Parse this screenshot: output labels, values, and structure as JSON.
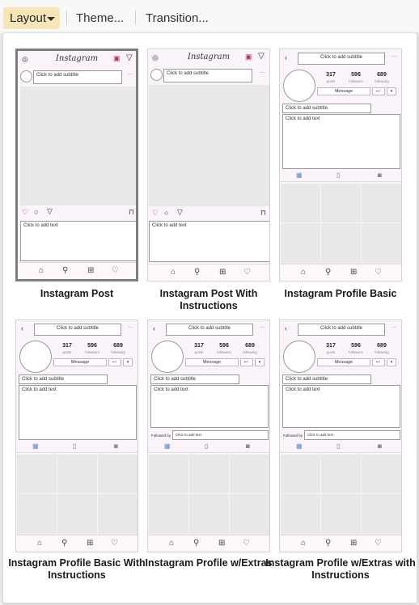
{
  "toolbar": {
    "layout_label": "Layout",
    "theme_label": "Theme...",
    "transition_label": "Transition..."
  },
  "strings": {
    "instagram": "Instagram",
    "subtitle": "Click to add subtitle",
    "text": "Click to add text",
    "message": "Message",
    "followed_by": "Followed by",
    "more": "···",
    "follow_check": "▪✓",
    "down": "▾"
  },
  "stats": {
    "posts_num": "317",
    "posts_lbl": "posts",
    "followers_num": "596",
    "followers_lbl": "followers",
    "following_num": "689",
    "following_lbl": "following"
  },
  "layouts": [
    {
      "name": "Instagram Post",
      "selected": true
    },
    {
      "name": "Instagram Post With Instructions",
      "selected": false
    },
    {
      "name": "Instagram Profile Basic",
      "selected": false
    },
    {
      "name": "Instagram Profile Basic With Instructions",
      "selected": false
    },
    {
      "name": "Instagram Profile w/Extras",
      "selected": false
    },
    {
      "name": "Instagram Profile w/Extras with Instructions",
      "selected": false
    }
  ],
  "colors": {
    "accent": "#f9e6b8",
    "thumb_bg": "#fbf3fa",
    "placeholder_gray": "#e8e8e8",
    "active_tab": "#5b8fd6"
  }
}
